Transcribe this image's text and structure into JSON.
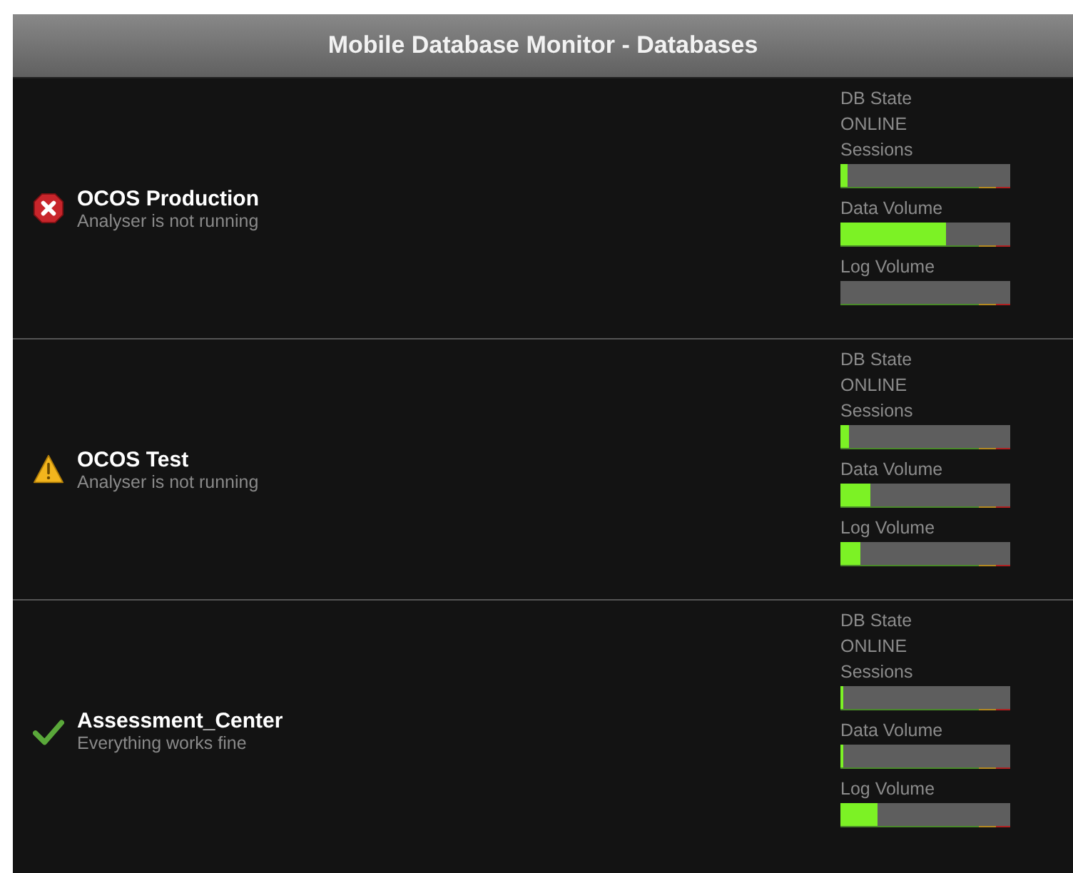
{
  "window": {
    "title": "Mobile Database Monitor - Databases"
  },
  "databases": [
    {
      "name": "OCOS Production",
      "kind": "error",
      "message": "Analyser is not running",
      "state_label": "DB State",
      "state": "ONLINE",
      "metrics": [
        {
          "label": "Sessions",
          "level": 0.04
        },
        {
          "label": "Data Volume",
          "level": 0.62
        },
        {
          "label": "Log Volume"
        }
      ]
    },
    {
      "name": "OCOS Test",
      "kind": "warning",
      "message": "Analyser is not running",
      "state_label": "DB State",
      "state": "ONLINE",
      "metrics": [
        {
          "label": "Sessions",
          "level": 0.05
        },
        {
          "label": "Data Volume",
          "level": 0.18
        },
        {
          "label": "Log Volume",
          "level": 0.12
        }
      ]
    },
    {
      "name": "Assessment_Center",
      "kind": "ok",
      "message": "Everything works fine",
      "state_label": "DB State",
      "state": "ONLINE",
      "metrics": [
        {
          "label": "Sessions",
          "level": 0.02
        },
        {
          "label": "Data Volume",
          "level": 0.02
        },
        {
          "label": "Log Volume",
          "level": 0.22
        }
      ]
    }
  ]
}
